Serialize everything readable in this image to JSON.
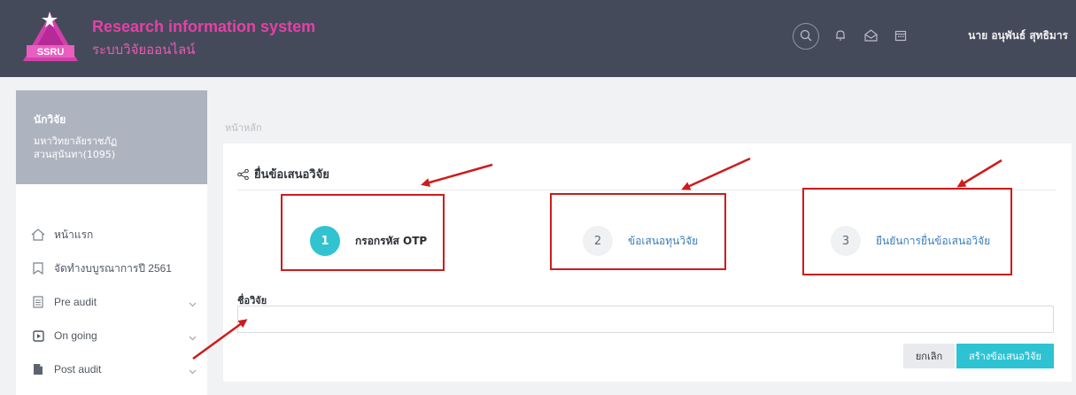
{
  "header": {
    "title": "Research information system",
    "subtitle": "ระบบวิจัยออนไลน์",
    "user_name": "นาย อนุพันธ์ สุทธิมาร",
    "logo_text": "SSRU",
    "icons": [
      "search-icon",
      "bell-icon",
      "mail-icon",
      "calendar-icon"
    ]
  },
  "sidebar": {
    "role": "นักวิจัย",
    "org_line1": "มหาวิทยาลัยราชภัฏ",
    "org_line2": "สวนสุนันทา(1095)",
    "items": [
      {
        "label": "หน้าแรก",
        "icon": "home-icon"
      },
      {
        "label": "จัดทำงบบูรณาการปี 2561",
        "icon": "bookmark-icon"
      },
      {
        "label": "Pre audit",
        "icon": "document-icon"
      },
      {
        "label": "On going",
        "icon": "play-icon"
      },
      {
        "label": "Post audit",
        "icon": "file-icon"
      }
    ]
  },
  "main": {
    "breadcrumb": "หน้าหลัก",
    "card_title": "ยื่นข้อเสนอวิจัย",
    "steps": [
      {
        "number": "1",
        "label": "กรอกรหัส OTP"
      },
      {
        "number": "2",
        "label": "ข้อเสนอทุนวิจัย"
      },
      {
        "number": "3",
        "label": "ยืนยันการยื่นข้อเสนอวิจัย"
      }
    ],
    "field_label": "ชื่อวิจัย",
    "field_value": "",
    "cancel_label": "ยกเลิก",
    "create_label": "สร้างข้อเสนอวิจัย"
  },
  "colors": {
    "topbar": "#444a5a",
    "brand": "#e73fa7",
    "accent": "#31c3d0",
    "annotation": "#cc1c1c"
  }
}
